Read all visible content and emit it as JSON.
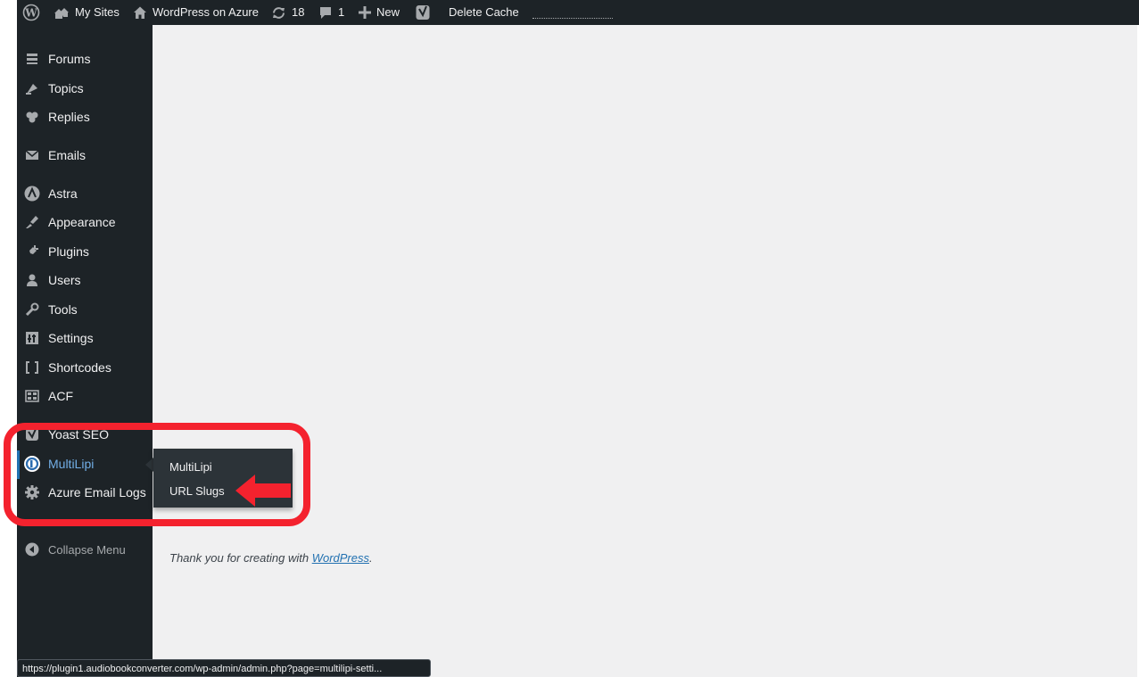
{
  "admin_bar": {
    "wp_logo_icon": "wordpress-logo-icon",
    "my_sites_label": "My Sites",
    "site_name": "WordPress on Azure",
    "updates_count": "18",
    "comments_count": "1",
    "new_label": "New",
    "yoast_icon": "yoast-icon",
    "delete_cache_label": "Delete Cache"
  },
  "sidebar": {
    "items": [
      {
        "label": "Forums",
        "icon": "forums-icon"
      },
      {
        "label": "Topics",
        "icon": "topics-icon"
      },
      {
        "label": "Replies",
        "icon": "replies-icon"
      },
      {
        "label": "Emails",
        "icon": "email-icon"
      },
      {
        "label": "Astra",
        "icon": "astra-icon"
      },
      {
        "label": "Appearance",
        "icon": "appearance-icon"
      },
      {
        "label": "Plugins",
        "icon": "plugins-icon"
      },
      {
        "label": "Users",
        "icon": "users-icon"
      },
      {
        "label": "Tools",
        "icon": "tools-icon"
      },
      {
        "label": "Settings",
        "icon": "settings-icon"
      },
      {
        "label": "Shortcodes",
        "icon": "shortcodes-icon"
      },
      {
        "label": "ACF",
        "icon": "acf-icon"
      },
      {
        "label": "Yoast SEO",
        "icon": "yoast-icon"
      },
      {
        "label": "MultiLipi",
        "icon": "multilipi-icon",
        "current": true
      },
      {
        "label": "Azure Email Logs",
        "icon": "gear-icon"
      },
      {
        "label": "Collapse Menu",
        "icon": "collapse-icon"
      }
    ]
  },
  "flyout": {
    "items": [
      {
        "label": "MultiLipi"
      },
      {
        "label": "URL Slugs"
      }
    ]
  },
  "footer": {
    "prefix": "Thank you for creating with ",
    "link_text": "WordPress",
    "suffix": "."
  },
  "status_bar": {
    "url": "https://plugin1.audiobookconverter.com/wp-admin/admin.php?page=multilipi-setti..."
  },
  "colors": {
    "admin_dark": "#1d2327",
    "content_bg": "#f0f0f1",
    "highlight_blue": "#72aee6",
    "annotation_red": "#f4222e"
  }
}
